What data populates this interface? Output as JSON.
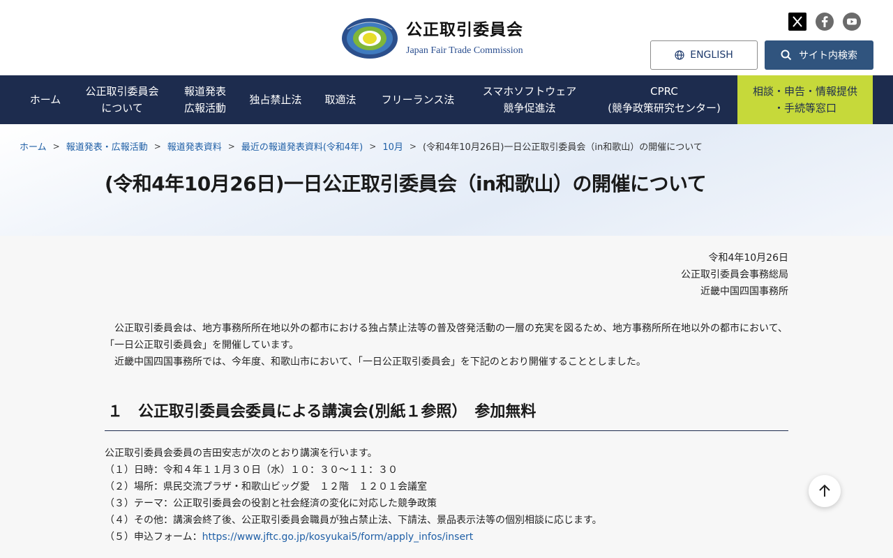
{
  "header": {
    "org_name_jp": "公正取引委員会",
    "org_name_en": "Japan Fair Trade Commission",
    "english_label": "ENGLISH",
    "search_label": "サイト内検索",
    "social": [
      "x-icon",
      "facebook-icon",
      "youtube-icon"
    ]
  },
  "nav": {
    "items": [
      {
        "label": "ホーム"
      },
      {
        "label": "公正取引委員会\nについて"
      },
      {
        "label": "報道発表\n広報活動"
      },
      {
        "label": "独占禁止法"
      },
      {
        "label": "取適法"
      },
      {
        "label": "フリーランス法"
      },
      {
        "label": "スマホソフトウェア\n競争促進法"
      },
      {
        "label": "CPRC\n(競争政策研究センター)"
      },
      {
        "label": "相談・申告・情報提供\n・手続等窓口"
      }
    ]
  },
  "breadcrumb": [
    "ホーム",
    "報道発表・広報活動",
    "報道発表資料",
    "最近の報道発表資料(令和4年)",
    "10月",
    "(令和4年10月26日)一日公正取引委員会（in和歌山）の開催について"
  ],
  "breadcrumb_sep": ">",
  "page": {
    "title": "(令和4年10月26日)一日公正取引委員会（in和歌山）の開催について",
    "date": "令和4年10月26日",
    "issuer1": "公正取引委員会事務総局",
    "issuer2": "近畿中国四国事務所",
    "intro1": "公正取引委員会は、地方事務所所在地以外の都市における独占禁止法等の普及啓発活動の一層の充実を図るため、地方事務所所在地以外の都市において、「一日公正取引委員会」を開催しています。",
    "intro2": "近畿中国四国事務所では、今年度、和歌山市において、「一日公正取引委員会」を下記のとおり開催することとしました。",
    "section1_heading": "１　公正取引委員会委員による講演会(別紙１参照）　参加無料",
    "lecture_intro": "公正取引委員会委員の吉田安志が次のとおり講演を行います。",
    "item1": "（１）日時：令和４年１１月３０日（水）１０：３０～１１：３０",
    "item2": "（２）場所：県民交流プラザ・和歌山ビッグ愛　１２階　１２０１会議室",
    "item3": "（３）テーマ：公正取引委員会の役割と社会経済の変化に対応した競争政策",
    "item4": "（４）その他：講演会終了後、公正取引委員会職員が独占禁止法、下請法、景品表示法等の個別相談に応じます。",
    "item5_prefix": "（５）申込フォーム：",
    "item5_link": "https://www.jftc.go.jp/kosyukai5/form/apply_infos/insert"
  },
  "colors": {
    "nav_bg": "#1d2c4e",
    "consult_bg": "#c6d93a",
    "search_bg": "#30547e",
    "link": "#1f5fa6"
  }
}
